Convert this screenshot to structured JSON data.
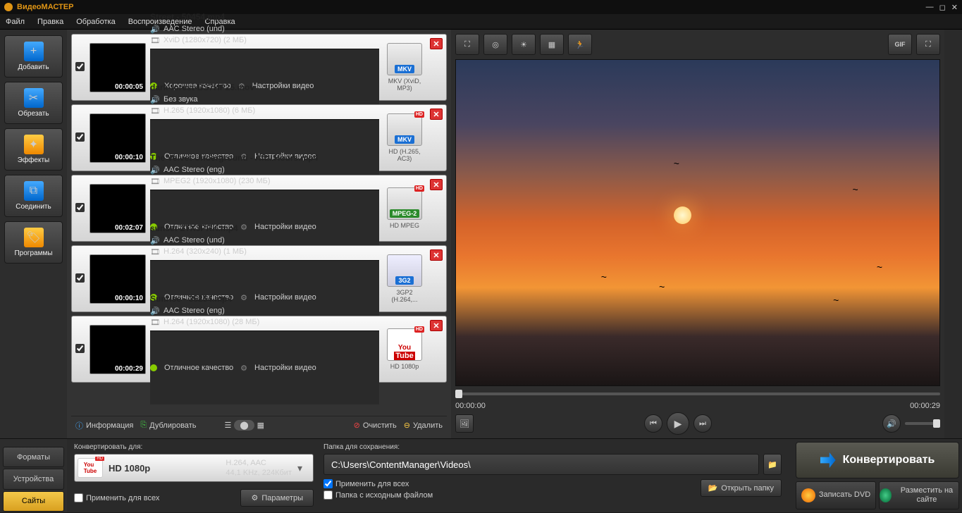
{
  "app": {
    "title": "ВидеоМАСТЕР"
  },
  "menu": {
    "file": "Файл",
    "edit": "Правка",
    "process": "Обработка",
    "playback": "Воспроизведение",
    "help": "Справка"
  },
  "tools": {
    "add": "Добавить",
    "cut": "Обрезать",
    "effects": "Эффекты",
    "join": "Соединить",
    "programs": "Программы"
  },
  "files": [
    {
      "name": "Street - 50454.mp4",
      "audio": "AAC Stereo (und)",
      "codec": "XviD (1280x720) (2 МБ)",
      "quality": "Хорошее качество",
      "settings": "Настройки видео",
      "dur": "00:00:05",
      "fmt": "MKV",
      "fmtbar": "MKV",
      "sub": "MKV (XviD, MP3)",
      "hd": false,
      "thumb": "th-dark"
    },
    {
      "name": "dark-forest-BS7HP25.mov",
      "audio": "Без звука",
      "codec": "H.265 (1920x1080) (6 МБ)",
      "quality": "Отличное качество",
      "settings": "Настройки видео",
      "dur": "00:00:10",
      "fmt": "MKV",
      "fmtbar": "MKV",
      "sub": "HD (H.265, AC3)",
      "hd": true,
      "thumb": "th-fog"
    },
    {
      "name": "The Velvet Underground - Aft...Hours.mp4",
      "audio": "AAC Stereo (eng)",
      "codec": "MPEG2 (1920x1080) (230 МБ)",
      "quality": "Отличное качество",
      "settings": "Настройки видео",
      "dur": "00:02:07",
      "fmt": "MPEG-2",
      "fmtbar": "MPEG-2",
      "sub": "HD MPEG",
      "hd": true,
      "thumb": "th-red",
      "mpeg": true
    },
    {
      "name": "sunset-2TX3PRK.mp4",
      "audio": "AAC Stereo (und)",
      "codec": "H.264 (320x240) (1 МБ)",
      "quality": "Отличное качество",
      "settings": "Настройки видео",
      "dur": "00:00:10",
      "fmt": "3G2",
      "fmtbar": "3G2",
      "sub": "3GP2 (H.264,...",
      "hd": false,
      "thumb": "th-sun",
      "tg": true
    },
    {
      "name": "Sunrise - 35254.mp4",
      "audio": "AAC Stereo (eng)",
      "codec": "H.264 (1920x1080) (28 МБ)",
      "quality": "Отличное качество",
      "settings": "Настройки видео",
      "dur": "00:00:29",
      "fmt": "YouTube",
      "fmtbar": "You",
      "sub": "HD 1080p",
      "hd": true,
      "thumb": "th-rise",
      "yt": true
    }
  ],
  "listtools": {
    "info": "Информация",
    "dup": "Дублировать",
    "clear": "Очистить",
    "del": "Удалить"
  },
  "preview": {
    "t1": "00:00:00",
    "t2": "00:00:29",
    "gif": "GIF"
  },
  "tabs": {
    "formats": "Форматы",
    "devices": "Устройства",
    "sites": "Сайты"
  },
  "conv": {
    "hdr": "Конвертировать для:",
    "fmt": "HD 1080p",
    "det1": "H.264, AAC",
    "det2": "44,1 KHz, 224Кбит",
    "apply": "Применить для всех",
    "params": "Параметры"
  },
  "folder": {
    "hdr": "Папка для сохранения:",
    "path": "C:\\Users\\ContentManager\\Videos\\",
    "open": "Открыть папку",
    "apply": "Применить для всех",
    "src": "Папка с исходным файлом"
  },
  "actions": {
    "convert": "Конвертировать",
    "dvd": "Записать DVD",
    "site": "Разместить на сайте"
  }
}
